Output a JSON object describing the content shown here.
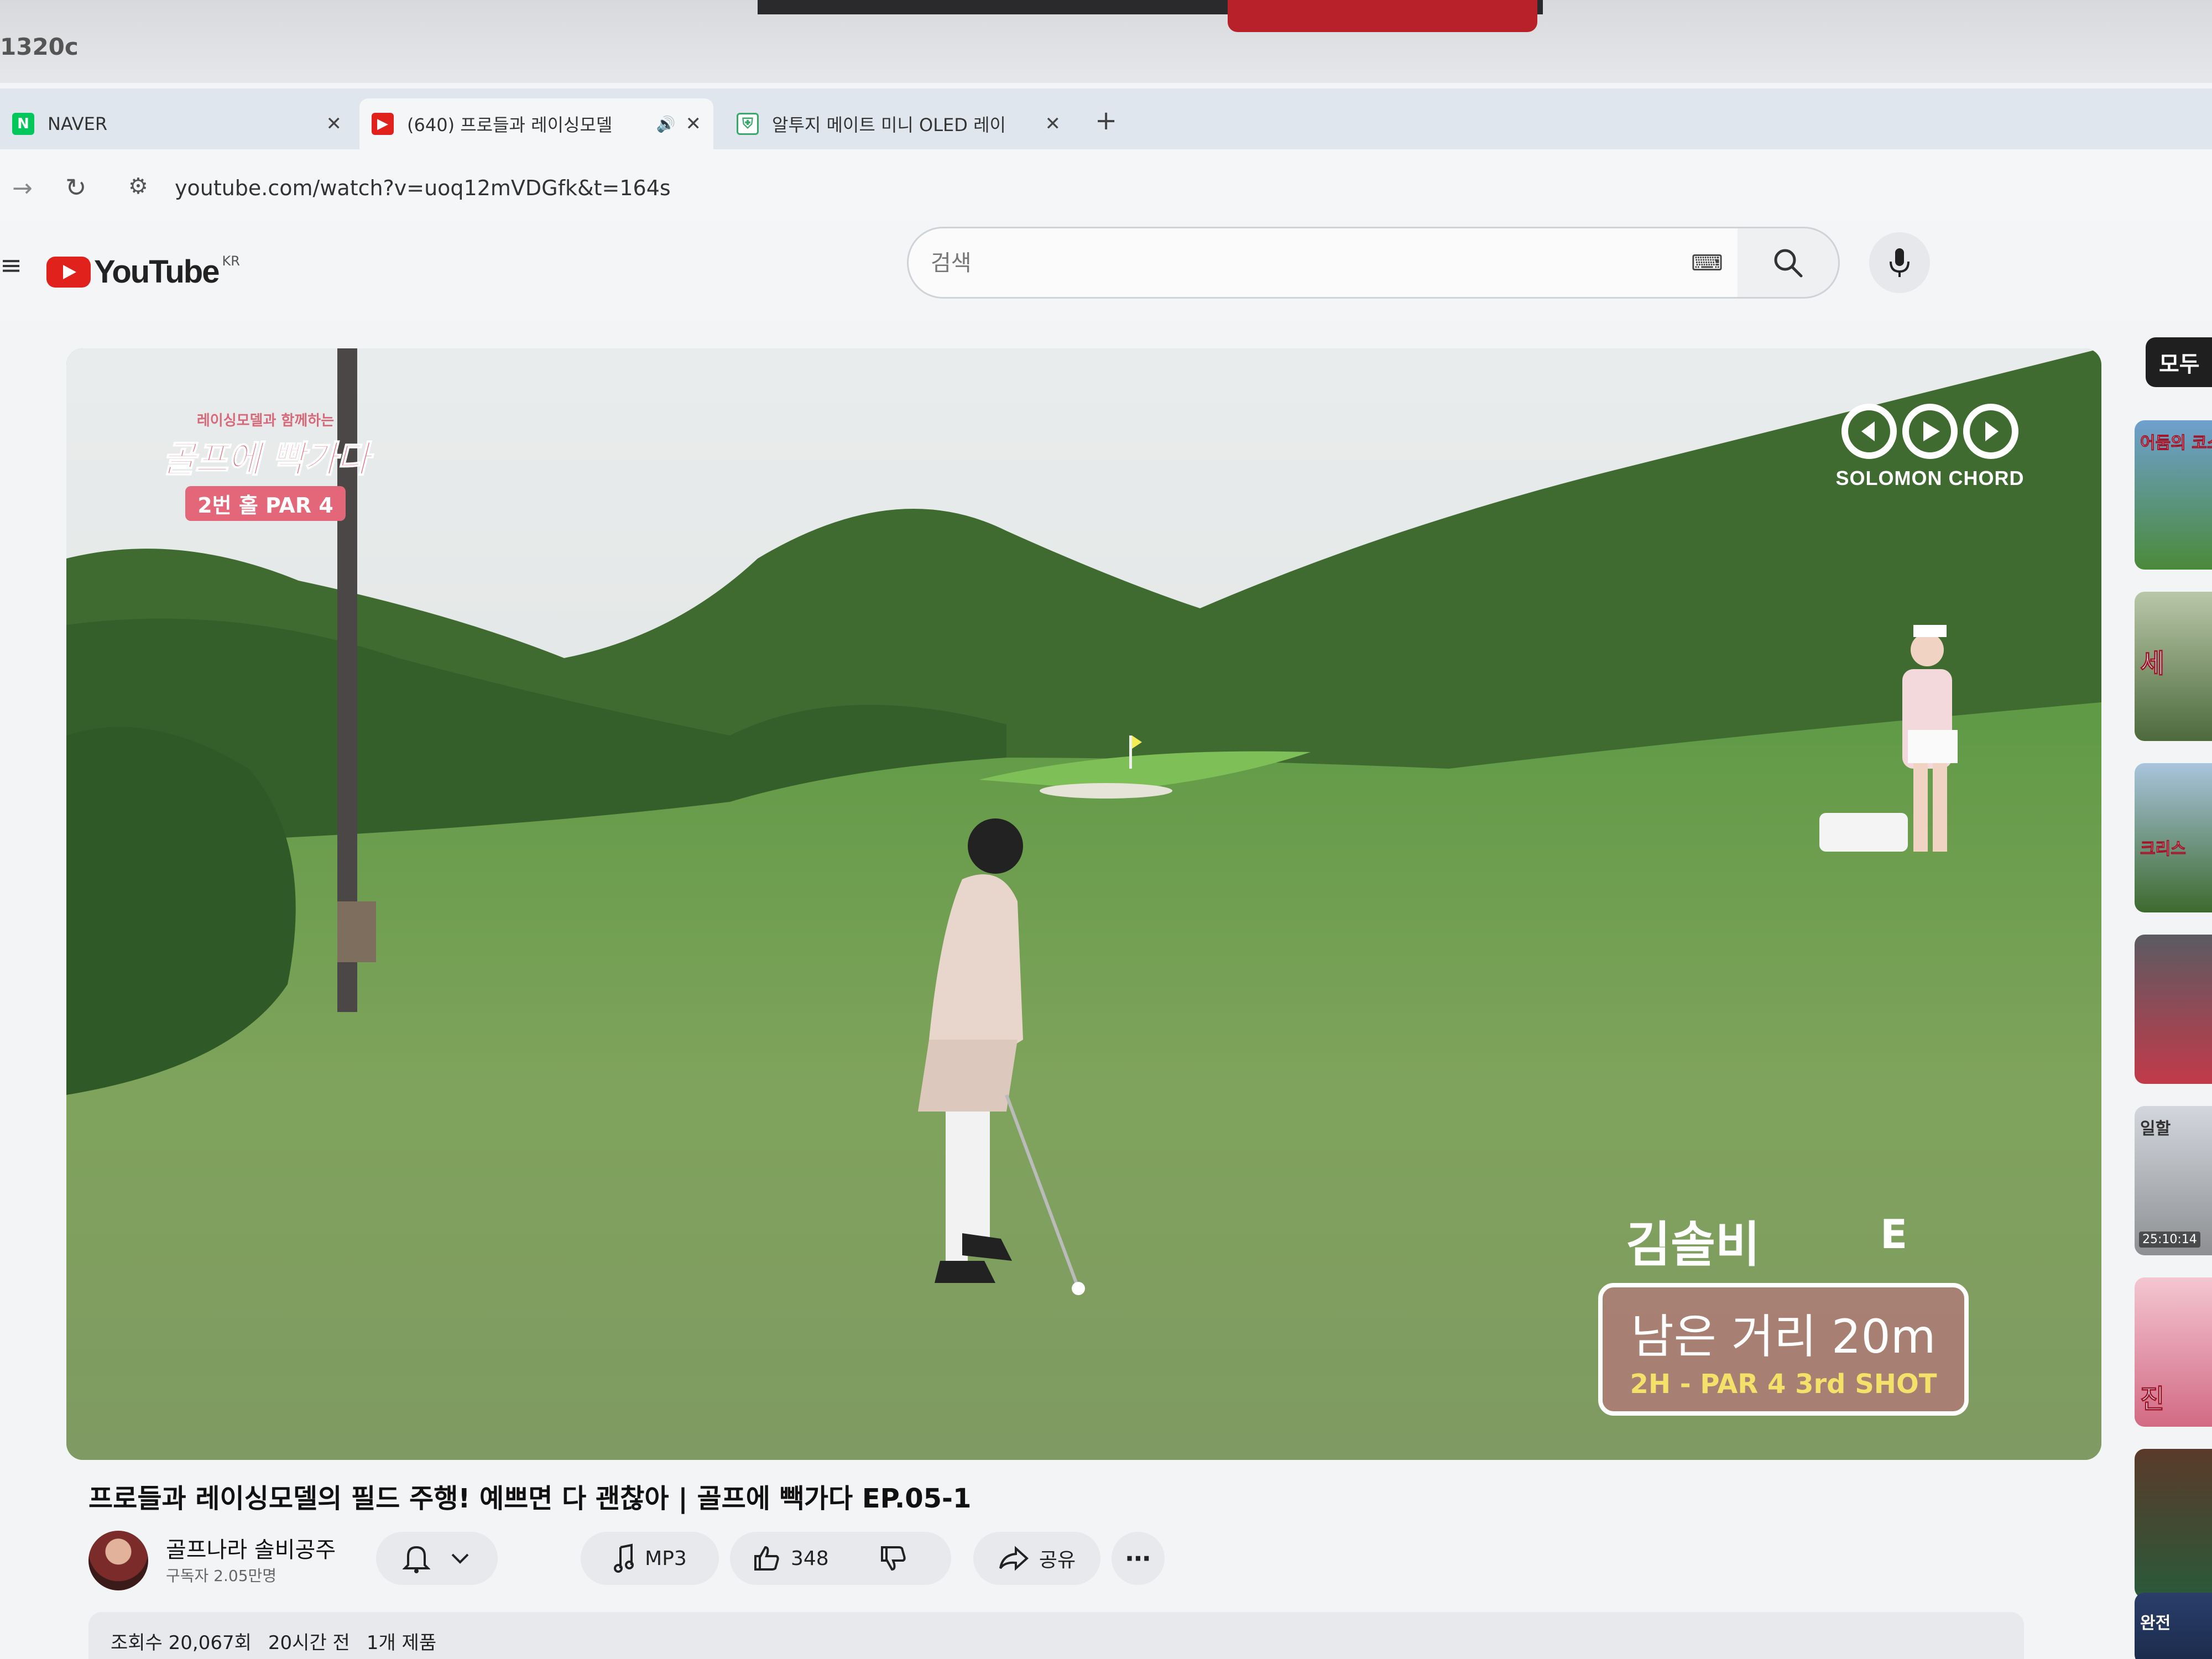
{
  "window": {
    "label": "1320c"
  },
  "tabs": [
    {
      "title": "NAVER",
      "icon": "naver-favicon-icon",
      "active": false
    },
    {
      "title": "(640) 프로들과 레이싱모델",
      "icon": "youtube-favicon-icon",
      "active": true,
      "audio": true
    },
    {
      "title": "알투지 메이트 미니 OLED 레이",
      "icon": "shop-favicon-icon",
      "active": false
    }
  ],
  "address_bar": {
    "url": "youtube.com/watch?v=uoq12mVDGfk&t=164s"
  },
  "youtube": {
    "logo_text": "YouTube",
    "region": "KR",
    "search_placeholder": "검색"
  },
  "video": {
    "overlay": {
      "show_tagline": "레이싱모델과 함께하는",
      "show_name": "골프에 빡가다",
      "hole_badge": "2번 홀 PAR 4",
      "brand": "SOLOMON CHORD",
      "player_name": "김솔비",
      "player_score": "E",
      "distance": "남은 거리 20m",
      "shot_info": "2H - PAR 4 3rd SHOT"
    },
    "title": "프로들과 레이싱모델의 필드 주행! 예쁘면 다 괜찮아 | 골프에 빽가다 EP.05-1",
    "channel_name": "골프나라 솔비공주",
    "subscribers": "구독자 2.05만명",
    "actions": {
      "mp3": "MP3",
      "likes": "348",
      "share": "공유"
    },
    "meta": {
      "views": "조회수 20,067회",
      "age": "20시간 전",
      "products": "1개 제품"
    }
  },
  "sidebar": {
    "chip": "모두",
    "thumbnails": [
      {
        "caption": "어둠의 코스",
        "timestamp": ""
      },
      {
        "caption": "세",
        "timestamp": ""
      },
      {
        "caption": "크리스",
        "timestamp": ""
      },
      {
        "caption": "",
        "timestamp": ""
      },
      {
        "caption": "일할",
        "timestamp": "25:10:14"
      },
      {
        "caption": "진",
        "timestamp": ""
      },
      {
        "caption": "",
        "timestamp": ""
      },
      {
        "caption": "완전",
        "timestamp": ""
      }
    ]
  },
  "colors": {
    "youtube_red": "#e1211b",
    "overlay_pink": "#e36779",
    "shot_yellow": "#f3e16a"
  }
}
